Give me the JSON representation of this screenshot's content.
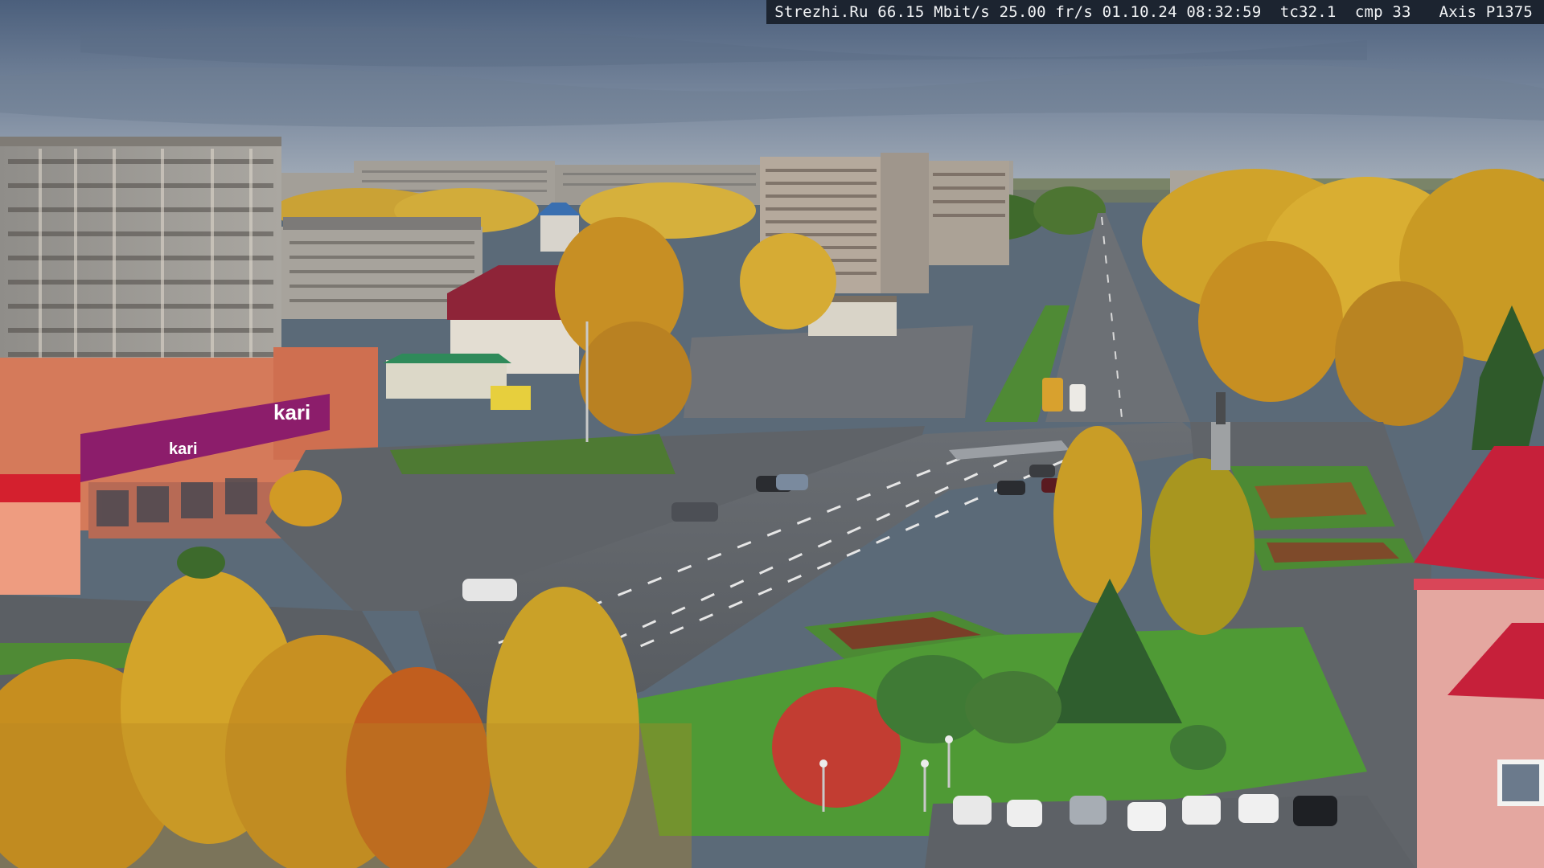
{
  "overlay": {
    "text": "Strezhi.Ru 66.15 Mbit/s 25.00 fr/s 01.10.24 08:32:59  tc32.1  cmp 33   Axis P1375"
  },
  "scene": {
    "store_sign_main": "kari",
    "store_sign_small": "kari"
  },
  "colors": {
    "sky_top": "#4e6380",
    "sky_bottom": "#8e9bab",
    "asphalt": "#5d6166",
    "grass": "#4c8a32",
    "foliage_yellow": "#d3a62a",
    "foliage_orange": "#c98a22",
    "roof_red": "#b8253c",
    "sign_magenta": "#8c1d6b"
  }
}
